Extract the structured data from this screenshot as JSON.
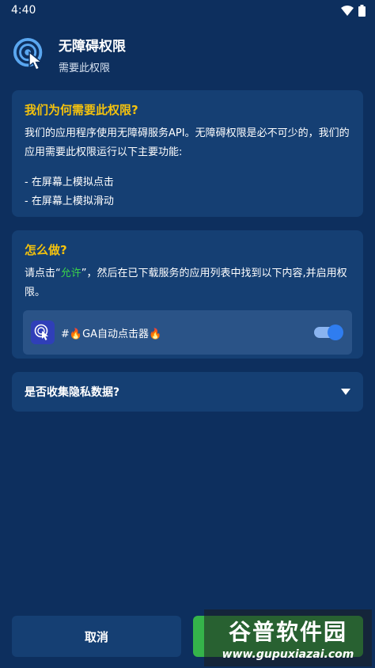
{
  "status_bar": {
    "time": "4:40",
    "wifi_icon": "wifi-icon",
    "battery_icon": "battery-icon"
  },
  "header": {
    "icon": "touch-target-icon",
    "title": "无障碍权限",
    "subtitle": "需要此权限"
  },
  "why_card": {
    "title": "我们为何需要此权限?",
    "body": "我们的应用程序使用无障碍服务API。无障碍权限是必不可少的，我们的应用需要此权限运行以下主要功能:",
    "bullets": [
      "- 在屏幕上模拟点击",
      "- 在屏幕上模拟滑动"
    ]
  },
  "how_card": {
    "title": "怎么做?",
    "body_prefix": "请点击“",
    "body_highlight": "允许",
    "body_suffix": "”，然后在已下载服务的应用列表中找到以下内容,并启用权限。",
    "service": {
      "icon": "touch-target-icon",
      "name": "#🔥GA自动点击器🔥",
      "toggle_on": true
    }
  },
  "privacy_card": {
    "title": "是否收集隐私数据?",
    "icon": "caret-down-icon"
  },
  "buttons": {
    "cancel": "取消",
    "allow": ""
  },
  "watermark": {
    "text_cn": "谷普软件园",
    "url": "www.gupuxiazai.com"
  },
  "colors": {
    "background": "#0d2f5e",
    "card": "#153f73",
    "title_accent": "#f4c20d",
    "allow_green": "#35b44a",
    "toggle_blue": "#2f7df0"
  }
}
